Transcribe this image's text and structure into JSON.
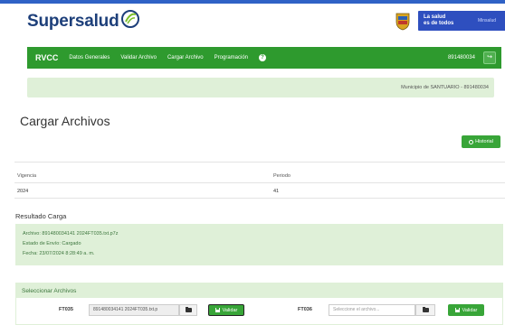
{
  "header": {
    "logo_text": "Supersalud",
    "gov_line1": "La salud",
    "gov_line2": "es de todos",
    "gov_ministry": "Minsalud"
  },
  "navbar": {
    "brand": "RVCC",
    "items": [
      {
        "label": "Datos Generales"
      },
      {
        "label": "Validar Archivo"
      },
      {
        "label": "Cargar Archivo"
      },
      {
        "label": "Programación"
      }
    ],
    "help_icon": "question-circle-icon",
    "code": "891480034",
    "exit_icon": "sign-out-icon",
    "color": "#2e9a2e"
  },
  "municipality": "Municipio de SANTUARIO - 891480034",
  "page_title": "Cargar Archivos",
  "history_button": "Historial",
  "info_table": {
    "headers": [
      "Vigencia",
      "Periodo"
    ],
    "values": [
      "2024",
      "41"
    ]
  },
  "result": {
    "title": "Resultado Carga",
    "archivo": "Archivo: 891480034141 2024FT035.txt.p7z",
    "estado": "Estado de Envío: Cargado",
    "fecha": "Fecha: 23/07/2024 8:28:49 a. m."
  },
  "select_files": {
    "title": "Seleccionar Archivos",
    "rows": [
      {
        "code": "FT035",
        "value": "891480034141 2024FT035.txt.p",
        "placeholder": "",
        "button": "Validar"
      },
      {
        "code": "FT036",
        "value": "",
        "placeholder": "Seleccione el archivo...",
        "button": "Validar"
      }
    ]
  }
}
